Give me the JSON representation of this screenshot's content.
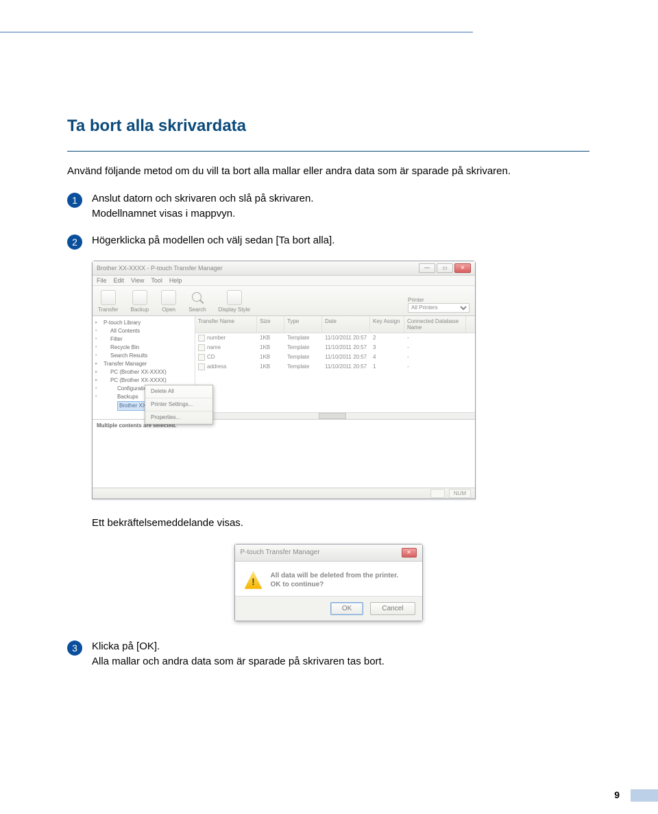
{
  "page": {
    "number": "9"
  },
  "heading": "Ta bort alla skrivardata",
  "intro": "Använd följande metod om du vill ta bort alla mallar eller andra data som är sparade på skrivaren.",
  "steps": {
    "s1": {
      "num": "1",
      "line1": "Anslut datorn och skrivaren och slå på skrivaren.",
      "line2": "Modellnamnet visas i mappvyn."
    },
    "s2": {
      "num": "2",
      "text": "Högerklicka på modellen och välj sedan [Ta bort alla]."
    },
    "caption": "Ett bekräftelsemeddelande visas.",
    "s3": {
      "num": "3",
      "line1": "Klicka på [OK].",
      "line2": "Alla mallar och andra data som är sparade på skrivaren tas bort."
    }
  },
  "app": {
    "title": "Brother XX-XXXX - P-touch Transfer Manager",
    "menu": [
      "File",
      "Edit",
      "View",
      "Tool",
      "Help"
    ],
    "toolbar": {
      "transfer": "Transfer",
      "backup": "Backup",
      "open": "Open",
      "search": "Search",
      "display": "Display Style",
      "printerLabel": "Printer",
      "printerValue": "All Printers"
    },
    "tree": {
      "lib": "P-touch Library",
      "all": "All Contents",
      "filter": "Filter",
      "recycle": "Recycle Bin",
      "search": "Search Results",
      "mgr": "Transfer Manager",
      "pc1": "PC (Brother XX-XXXX)",
      "pc2": "PC (Brother XX-XXXX)",
      "config": "Configurations",
      "backups": "Backups",
      "model": "Brother XX-XXXX"
    },
    "context": {
      "deleteAll": "Delete All",
      "printerSettings": "Printer Settings...",
      "properties": "Properties..."
    },
    "columns": {
      "name": "Transfer Name",
      "size": "Size",
      "type": "Type",
      "date": "Date",
      "key": "Key Assign",
      "db": "Connected Database Name"
    },
    "rows": [
      {
        "name": "number",
        "size": "1KB",
        "type": "Template",
        "date": "11/10/2011 20:57",
        "key": "2",
        "db": "-"
      },
      {
        "name": "name",
        "size": "1KB",
        "type": "Template",
        "date": "11/10/2011 20:57",
        "key": "3",
        "db": "-"
      },
      {
        "name": "CD",
        "size": "1KB",
        "type": "Template",
        "date": "11/10/2011 20:57",
        "key": "4",
        "db": "-"
      },
      {
        "name": "address",
        "size": "1KB",
        "type": "Template",
        "date": "11/10/2011 20:57",
        "key": "1",
        "db": "-"
      }
    ],
    "preview": "Multiple contents are selected.",
    "status": "NUM"
  },
  "dialog": {
    "title": "P-touch Transfer Manager",
    "line1": "All data will be deleted from the printer.",
    "line2": "OK to continue?",
    "ok": "OK",
    "cancel": "Cancel"
  }
}
